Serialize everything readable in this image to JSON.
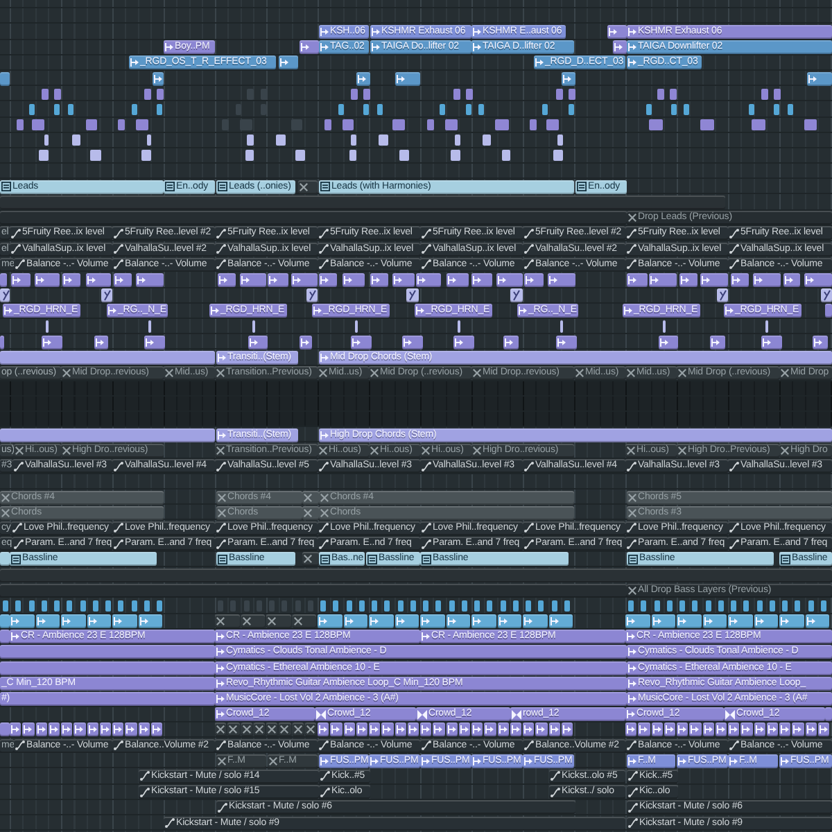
{
  "playlist": {
    "tracks": [
      {
        "clips": [
          {
            "kind": "audio",
            "color": "#7e8fd8",
            "label": "KSH..06"
          },
          {
            "kind": "audio",
            "color": "#7e8fd8",
            "label": "KSHMR Exhaust 06"
          },
          {
            "kind": "audio",
            "color": "#7e8fd8",
            "label": "KSHMR E..aust 06"
          },
          {
            "kind": "audio",
            "color": "#8c86d3"
          },
          {
            "kind": "audio",
            "color": "#8c86d3",
            "label": "KSHMR Exhaust 06"
          }
        ]
      },
      {
        "clips": [
          {
            "kind": "audio",
            "color": "#8c86d3",
            "label": "Boy..PM"
          },
          {
            "kind": "audio",
            "color": "#8c86d3"
          },
          {
            "kind": "audio",
            "color": "#5b97c8",
            "label": "TAG..02"
          },
          {
            "kind": "audio",
            "color": "#5b97c8",
            "label": "TAIGA Do..lifter 02"
          },
          {
            "kind": "audio",
            "color": "#5b97c8",
            "label": "TAIGA D..lifter 02"
          },
          {
            "kind": "audio",
            "color": "#8c86d3"
          },
          {
            "kind": "audio",
            "color": "#5b97c8",
            "label": "TAIGA Downlifter 02"
          }
        ]
      },
      {
        "clips": [
          {
            "kind": "audio",
            "color": "#5b97c8",
            "label": "_RGD_OS_T_R_EFFECT_03"
          },
          {
            "kind": "audio",
            "color": "#5b97c8"
          },
          {
            "kind": "audio",
            "color": "#5b97c8",
            "label": "_RGD_D..ECT_03"
          },
          {
            "kind": "audio",
            "color": "#5b97c8",
            "label": "_RGD..CT_03"
          }
        ]
      },
      {
        "clips": [
          {
            "kind": "plain",
            "color": "#5b97c8"
          },
          {
            "kind": "audio",
            "color": "#5b97c8"
          },
          {
            "kind": "audio",
            "color": "#5b97c8"
          },
          {
            "kind": "audio",
            "color": "#5b97c8"
          },
          {
            "kind": "audio",
            "color": "#5b97c8"
          },
          {
            "kind": "audio",
            "color": "#5b97c8"
          }
        ]
      },
      {
        "clips": [
          {
            "kind": "notes",
            "color": "#8f86d4"
          },
          {
            "kind": "notes",
            "color": "#39434a"
          },
          {
            "kind": "notes",
            "color": "#8f86d4"
          }
        ]
      },
      {
        "clips": [
          {
            "kind": "notes",
            "color": "#55a7d6"
          },
          {
            "kind": "notes",
            "color": "#39434a"
          },
          {
            "kind": "notes",
            "color": "#55a7d6"
          }
        ]
      },
      {
        "clips": [
          {
            "kind": "notes",
            "color": "#8f86d4"
          },
          {
            "kind": "notes",
            "color": "#39434a"
          },
          {
            "kind": "notes",
            "color": "#8f86d4"
          }
        ]
      },
      {
        "clips": [
          {
            "kind": "notes",
            "color": "#b7bbea"
          }
        ]
      },
      {
        "clips": [
          {
            "kind": "notes",
            "color": "#b7bbea"
          }
        ]
      },
      {
        "clips": [
          {
            "kind": "pattern",
            "color": "#a6cfe0",
            "label": "Leads"
          },
          {
            "kind": "pattern",
            "color": "#a6cfe0",
            "label": "En..ody"
          },
          {
            "kind": "pattern",
            "color": "#a6cfe0",
            "label": "Leads (..onies)"
          },
          {
            "kind": "muted",
            "color": "#30383c"
          },
          {
            "kind": "pattern",
            "color": "#a6cfe0",
            "label": "Leads (with Harmonies)"
          },
          {
            "kind": "pattern",
            "color": "#a6cfe0",
            "label": "En..ody"
          }
        ]
      },
      {
        "clips": [
          {
            "kind": "plain",
            "color": "#2a3135"
          }
        ]
      },
      {
        "clips": [
          {
            "kind": "plain",
            "color": "#262d31"
          },
          {
            "kind": "muted",
            "color": "#262d31",
            "label": "Drop Leads (Previous)"
          }
        ]
      },
      {
        "clips": [
          {
            "kind": "plain",
            "color": "#283035",
            "label": "el"
          },
          {
            "kind": "automation",
            "color": "#283035",
            "label": "5Fruity Ree..ix level"
          },
          {
            "kind": "automation",
            "color": "#283035",
            "label": "5Fruity Ree..level #2"
          },
          {
            "kind": "automation",
            "color": "#283035",
            "label": "5Fruity Ree..ix level"
          },
          {
            "kind": "automation",
            "color": "#283035",
            "label": "5Fruity Ree..ix level"
          },
          {
            "kind": "automation",
            "color": "#283035",
            "label": "5Fruity Ree..ix level"
          },
          {
            "kind": "automation",
            "color": "#283035",
            "label": "5Fruity Ree..level #2"
          },
          {
            "kind": "automation",
            "color": "#283035",
            "label": "5Fruity Ree..ix level"
          },
          {
            "kind": "automation",
            "color": "#283035",
            "label": "5Fruity Ree..ix level"
          }
        ]
      },
      {
        "clips": [
          {
            "kind": "plain",
            "color": "#283035",
            "label": "el"
          },
          {
            "kind": "automation",
            "color": "#283035",
            "label": "ValhallaSup..ix level"
          },
          {
            "kind": "automation",
            "color": "#283035",
            "label": "ValhallaSu..level #2"
          },
          {
            "kind": "automation",
            "color": "#283035",
            "label": "ValhallaSup..ix level"
          },
          {
            "kind": "automation",
            "color": "#283035",
            "label": "ValhallaSup..ix level"
          },
          {
            "kind": "automation",
            "color": "#283035",
            "label": "ValhallaSup..ix level"
          },
          {
            "kind": "automation",
            "color": "#283035",
            "label": "ValhallaSu..level #2"
          },
          {
            "kind": "automation",
            "color": "#283035",
            "label": "ValhallaSup..ix level"
          },
          {
            "kind": "automation",
            "color": "#283035",
            "label": "ValhallaSup..ix level"
          }
        ]
      },
      {
        "clips": [
          {
            "kind": "plain",
            "color": "#283035",
            "label": "me"
          },
          {
            "kind": "automation",
            "color": "#283035",
            "label": "Balance -..- Volume"
          },
          {
            "kind": "automation",
            "color": "#283035",
            "label": "Balance -..- Volume"
          },
          {
            "kind": "automation",
            "color": "#283035",
            "label": "Balance -..- Volume"
          },
          {
            "kind": "automation",
            "color": "#283035",
            "label": "Balance -..- Volume"
          },
          {
            "kind": "automation",
            "color": "#283035",
            "label": "Balance -..- Volume"
          },
          {
            "kind": "automation",
            "color": "#283035",
            "label": "Balance -..- Volume"
          },
          {
            "kind": "automation",
            "color": "#283035",
            "label": "Balance -..- Volume"
          },
          {
            "kind": "automation",
            "color": "#283035",
            "label": "Balance -..- Volume"
          }
        ]
      },
      {
        "clips": [
          {
            "kind": "run",
            "color": "#8c86d3"
          },
          {
            "kind": "run",
            "color": "#8c86d3"
          },
          {
            "kind": "run",
            "color": "#8c86d3"
          }
        ]
      },
      {
        "clips": [
          {
            "kind": "ramp",
            "color": "#b7bbea"
          },
          {
            "kind": "ramp",
            "color": "#b7bbea"
          },
          {
            "kind": "ramp",
            "color": "#b7bbea"
          },
          {
            "kind": "ramp",
            "color": "#b7bbea"
          },
          {
            "kind": "ramp",
            "color": "#b7bbea"
          },
          {
            "kind": "ramp",
            "color": "#b7bbea"
          },
          {
            "kind": "ramp",
            "color": "#b7bbea"
          }
        ]
      },
      {
        "clips": [
          {
            "kind": "audio",
            "color": "#8c86d3",
            "label": "_RGD_HRN_E"
          },
          {
            "kind": "audio",
            "color": "#8c86d3",
            "label": "_RG.._N_E"
          },
          {
            "kind": "audio",
            "color": "#8c86d3",
            "label": "_RGD_HRN_E"
          },
          {
            "kind": "audio",
            "color": "#8c86d3",
            "label": "_RGD_HRN_E"
          },
          {
            "kind": "audio",
            "color": "#8c86d3",
            "label": "_RGD_HRN_E"
          },
          {
            "kind": "audio",
            "color": "#8c86d3",
            "label": "_RG.._N_E"
          },
          {
            "kind": "audio",
            "color": "#8c86d3",
            "label": "_RGD_HRN_E"
          },
          {
            "kind": "audio",
            "color": "#8c86d3",
            "label": "_RGD_HRN_E"
          },
          {
            "kind": "plain",
            "color": "#8c86d3"
          }
        ]
      },
      {
        "clips": [
          {
            "kind": "notes",
            "color": "#b7bbea"
          }
        ]
      },
      {
        "clips": [
          {
            "kind": "run",
            "color": "#8c86d3"
          },
          {
            "kind": "run",
            "color": "#8c86d3"
          },
          {
            "kind": "run",
            "color": "#8c86d3"
          }
        ]
      },
      {
        "clips": [
          {
            "kind": "plain",
            "color": "#a0a2e2"
          },
          {
            "kind": "audio",
            "color": "#a0a2e2",
            "label": "Transiti..(Stem)"
          },
          {
            "kind": "audio",
            "color": "#a0a2e2",
            "label": "Mid Drop Chords (Stem)"
          }
        ]
      },
      {
        "clips": [
          {
            "kind": "plain",
            "color": "#30383c",
            "label": "op (..revious)"
          },
          {
            "kind": "muted",
            "color": "#30383c",
            "label": "Mid Drop..revious)"
          },
          {
            "kind": "muted",
            "color": "#30383c",
            "label": "Mid..us)"
          },
          {
            "kind": "muted",
            "color": "#30383c",
            "label": "Transition..Previous)"
          },
          {
            "kind": "muted",
            "color": "#30383c",
            "label": "Mid..us)"
          },
          {
            "kind": "muted",
            "color": "#30383c",
            "label": "Mid Drop (..revious)"
          },
          {
            "kind": "muted",
            "color": "#30383c",
            "label": "Mid Drop..revious)"
          },
          {
            "kind": "muted",
            "color": "#30383c",
            "label": "Mid..us)"
          },
          {
            "kind": "muted",
            "color": "#30383c",
            "label": "Mid..us)"
          },
          {
            "kind": "muted",
            "color": "#30383c",
            "label": "Mid Drop (..revious)"
          },
          {
            "kind": "muted",
            "color": "#30383c",
            "label": "Mid Drop"
          }
        ]
      },
      {
        "clips": [
          {
            "kind": "band",
            "color": "#1d2326"
          }
        ]
      },
      {
        "clips": [
          {
            "kind": "band",
            "color": "#1d2326"
          }
        ]
      },
      {
        "clips": [
          {
            "kind": "band",
            "color": "#1d2326"
          }
        ]
      },
      {
        "clips": [
          {
            "kind": "plain",
            "color": "#a0a2e2"
          },
          {
            "kind": "audio",
            "color": "#a0a2e2",
            "label": "Transiti..(Stem)"
          },
          {
            "kind": "audio",
            "color": "#a0a2e2",
            "label": "High Drop Chords (Stem)"
          }
        ]
      },
      {
        "clips": [
          {
            "kind": "plain",
            "color": "#30383c",
            "label": "us)"
          },
          {
            "kind": "muted",
            "color": "#30383c",
            "label": "Hi..ous)"
          },
          {
            "kind": "muted",
            "color": "#30383c",
            "label": "High Dro..revious)"
          },
          {
            "kind": "muted",
            "color": "#30383c",
            "label": "Transition..Previous)"
          },
          {
            "kind": "muted",
            "color": "#30383c",
            "label": "Hi..ous)"
          },
          {
            "kind": "muted",
            "color": "#30383c",
            "label": "Hi..ous)"
          },
          {
            "kind": "muted",
            "color": "#30383c",
            "label": "Hi..ous)"
          },
          {
            "kind": "muted",
            "color": "#30383c",
            "label": "High Dro..revious)"
          },
          {
            "kind": "muted",
            "color": "#30383c",
            "label": "Hi..ous)"
          },
          {
            "kind": "muted",
            "color": "#30383c",
            "label": "High Dro..Previous)"
          },
          {
            "kind": "muted",
            "color": "#30383c",
            "label": "High Dro"
          }
        ]
      },
      {
        "clips": [
          {
            "kind": "plain",
            "color": "#283035",
            "label": "#3"
          },
          {
            "kind": "automation",
            "color": "#283035",
            "label": "ValhallaSu..level #3"
          },
          {
            "kind": "automation",
            "color": "#283035",
            "label": "ValhallaSu..level #4"
          },
          {
            "kind": "automation",
            "color": "#283035",
            "label": "ValhallaSu..level #5"
          },
          {
            "kind": "automation",
            "color": "#283035",
            "label": "ValhallaSu..level #3"
          },
          {
            "kind": "automation",
            "color": "#283035",
            "label": "ValhallaSu..level #3"
          },
          {
            "kind": "automation",
            "color": "#283035",
            "label": "ValhallaSu..level #4"
          },
          {
            "kind": "automation",
            "color": "#283035",
            "label": "ValhallaSu..level #3"
          },
          {
            "kind": "automation",
            "color": "#283035",
            "label": "ValhallaSu..level #3"
          }
        ]
      },
      {
        "clips": [
          {
            "kind": "muted",
            "color": "#4a5357",
            "label": "Chords #4"
          },
          {
            "kind": "muted",
            "color": "#4a5357",
            "label": "Chords #4"
          },
          {
            "kind": "muted",
            "color": "#4a5357"
          },
          {
            "kind": "muted",
            "color": "#4a5357",
            "label": "Chords #4"
          },
          {
            "kind": "muted",
            "color": "#4a5357",
            "label": "Chords #5"
          }
        ]
      },
      {
        "clips": [
          {
            "kind": "muted",
            "color": "#4a5357",
            "label": "Chords"
          },
          {
            "kind": "muted",
            "color": "#4a5357",
            "label": "Chords"
          },
          {
            "kind": "muted",
            "color": "#4a5357"
          },
          {
            "kind": "muted",
            "color": "#4a5357",
            "label": "Chords"
          },
          {
            "kind": "muted",
            "color": "#4a5357",
            "label": "Chords #3"
          }
        ]
      },
      {
        "clips": [
          {
            "kind": "plain",
            "color": "#283035",
            "label": "cy"
          },
          {
            "kind": "automation",
            "color": "#283035",
            "label": "Love Phil..frequency"
          },
          {
            "kind": "automation",
            "color": "#283035",
            "label": "Love Phil..frequency"
          },
          {
            "kind": "automation",
            "color": "#283035",
            "label": "Love Phil..frequency"
          },
          {
            "kind": "automation",
            "color": "#283035",
            "label": "Love Phil..frequency"
          },
          {
            "kind": "automation",
            "color": "#283035",
            "label": "Love Phil..frequency"
          },
          {
            "kind": "automation",
            "color": "#283035",
            "label": "Love Phil..frequency"
          },
          {
            "kind": "automation",
            "color": "#283035",
            "label": "Love Phil..frequency"
          },
          {
            "kind": "automation",
            "color": "#283035",
            "label": "Love Phil..frequency"
          }
        ]
      },
      {
        "clips": [
          {
            "kind": "plain",
            "color": "#283035",
            "label": "eq"
          },
          {
            "kind": "automation",
            "color": "#283035",
            "label": "Param. E..and 7 freq"
          },
          {
            "kind": "automation",
            "color": "#283035",
            "label": "Param. E..and 7 freq"
          },
          {
            "kind": "automation",
            "color": "#283035",
            "label": "Param. E..and 7 freq"
          },
          {
            "kind": "automation",
            "color": "#283035",
            "label": "Param. E..nd 7 freq"
          },
          {
            "kind": "automation",
            "color": "#283035",
            "label": "Param. E..and 7 freq"
          },
          {
            "kind": "automation",
            "color": "#283035",
            "label": "Param. E..and 7 freq"
          },
          {
            "kind": "automation",
            "color": "#283035",
            "label": "Param. E..and 7 freq"
          },
          {
            "kind": "automation",
            "color": "#283035",
            "label": "Param. E..and 7 freq"
          }
        ]
      },
      {
        "clips": [
          {
            "kind": "plain",
            "color": "#a6cfe0"
          },
          {
            "kind": "pattern",
            "color": "#a6cfe0",
            "label": "Bassline"
          },
          {
            "kind": "pattern",
            "color": "#a6cfe0",
            "label": "Bassline"
          },
          {
            "kind": "muted",
            "color": "#30383c"
          },
          {
            "kind": "pattern",
            "color": "#a6cfe0",
            "label": "Bas..ne"
          },
          {
            "kind": "pattern",
            "color": "#a6cfe0",
            "label": "Bassline"
          },
          {
            "kind": "pattern",
            "color": "#a6cfe0",
            "label": "Bassline"
          },
          {
            "kind": "pattern",
            "color": "#a6cfe0",
            "label": "Bassline"
          },
          {
            "kind": "pattern",
            "color": "#a6cfe0",
            "label": "Bassline"
          }
        ]
      },
      {
        "clips": [
          {
            "kind": "plain",
            "color": "#2a3135"
          }
        ]
      },
      {
        "clips": [
          {
            "kind": "plain",
            "color": "#262d31"
          },
          {
            "kind": "muted",
            "color": "#262d31",
            "label": "All Drop Bass Layers (Previous)"
          }
        ]
      },
      {
        "clips": [
          {
            "kind": "notes",
            "color": "#55a7d6"
          },
          {
            "kind": "notes",
            "color": "#39434a"
          },
          {
            "kind": "notes",
            "color": "#55a7d6"
          },
          {
            "kind": "notes",
            "color": "#55a7d6"
          }
        ]
      },
      {
        "clips": [
          {
            "kind": "plain",
            "color": "#63acd6"
          },
          {
            "kind": "run",
            "color": "#63acd6"
          },
          {
            "kind": "muted-run",
            "color": "#30383c"
          },
          {
            "kind": "run",
            "color": "#63acd6"
          },
          {
            "kind": "run",
            "color": "#63acd6"
          }
        ]
      },
      {
        "clips": [
          {
            "kind": "plain",
            "color": "#8c86d3"
          },
          {
            "kind": "audio",
            "color": "#8c86d3",
            "label": "CR - Ambience 23 E 128BPM"
          },
          {
            "kind": "audio",
            "color": "#8c86d3",
            "label": "CR - Ambience 23 E 128BPM"
          },
          {
            "kind": "audio",
            "color": "#8c86d3",
            "label": "CR - Ambience 23 E 128BPM"
          },
          {
            "kind": "audio",
            "color": "#8c86d3",
            "label": "CR - Ambience 23 E 128BPM"
          }
        ]
      },
      {
        "clips": [
          {
            "kind": "plain",
            "color": "#8c86d3"
          },
          {
            "kind": "audio",
            "color": "#8c86d3",
            "label": "Cymatics - Clouds Tonal Ambience - D"
          },
          {
            "kind": "audio",
            "color": "#8c86d3",
            "label": "Cymatics - Clouds Tonal Ambience - D"
          }
        ]
      },
      {
        "clips": [
          {
            "kind": "plain",
            "color": "#8c86d3"
          },
          {
            "kind": "audio",
            "color": "#8c86d3",
            "label": "Cymatics - Ethereal Ambience 10 - E"
          },
          {
            "kind": "audio",
            "color": "#8c86d3",
            "label": "Cymatics - Ethereal Ambience 10 - E"
          }
        ]
      },
      {
        "clips": [
          {
            "kind": "plain",
            "color": "#8c86d3",
            "label": "_C Min_120 BPM"
          },
          {
            "kind": "audio",
            "color": "#8c86d3",
            "label": "Revo_Rhythmic Guitar Ambience Loop_C Min_120 BPM"
          },
          {
            "kind": "audio",
            "color": "#8c86d3",
            "label": "Revo_Rhythmic Guitar Ambience Loop_"
          }
        ]
      },
      {
        "clips": [
          {
            "kind": "plain",
            "color": "#8c86d3",
            "label": "#)"
          },
          {
            "kind": "audio",
            "color": "#8c86d3",
            "label": "MusicCore - Lost Vol 2 Ambience - 3 (A#)"
          },
          {
            "kind": "audio",
            "color": "#8c86d3",
            "label": "MusicCore - Lost Vol 2 Ambience - 3 (A#"
          }
        ]
      },
      {
        "clips": [
          {
            "kind": "audio",
            "color": "#8c86d3",
            "label": "Crowd_12"
          },
          {
            "kind": "cross",
            "color": "#8c86d3",
            "label": "Crowd_12"
          },
          {
            "kind": "cross",
            "color": "#8c86d3",
            "label": "Crowd_12"
          },
          {
            "kind": "cross",
            "color": "#8c86d3",
            "label": "rowd_12"
          },
          {
            "kind": "audio",
            "color": "#8c86d3",
            "label": "Crowd_12"
          },
          {
            "kind": "cross",
            "color": "#8c86d3",
            "label": "Crowd_12"
          },
          {
            "kind": "plain",
            "color": "#8c86d3"
          }
        ]
      },
      {
        "clips": [
          {
            "kind": "plain",
            "color": "#8c86d3"
          },
          {
            "kind": "run",
            "color": "#8c86d3"
          },
          {
            "kind": "muted-run",
            "color": "#30383c"
          },
          {
            "kind": "run",
            "color": "#8c86d3"
          },
          {
            "kind": "run",
            "color": "#8c86d3"
          }
        ]
      },
      {
        "clips": [
          {
            "kind": "plain",
            "color": "#283035",
            "label": "me"
          },
          {
            "kind": "automation",
            "color": "#283035",
            "label": "Balance -..- Volume"
          },
          {
            "kind": "automation",
            "color": "#283035",
            "label": "Balance..Volume #2"
          },
          {
            "kind": "automation",
            "color": "#283035",
            "label": "Balance -..- Volume"
          },
          {
            "kind": "automation",
            "color": "#283035",
            "label": "Balance -..- Volume"
          },
          {
            "kind": "automation",
            "color": "#283035",
            "label": "Balance -..- Volume"
          },
          {
            "kind": "automation",
            "color": "#283035",
            "label": "Balance..Volume #2"
          },
          {
            "kind": "automation",
            "color": "#283035",
            "label": "Balance -..- Volume"
          },
          {
            "kind": "automation",
            "color": "#283035",
            "label": "Balance -..- Volume"
          }
        ]
      },
      {
        "clips": [
          {
            "kind": "muted",
            "color": "#30383c",
            "label": "F..M"
          },
          {
            "kind": "muted",
            "color": "#30383c",
            "label": "F..M"
          },
          {
            "kind": "audio",
            "color": "#7e8fd8",
            "label": "FUS..PM"
          },
          {
            "kind": "audio",
            "color": "#7e8fd8",
            "label": "FUS..PM"
          },
          {
            "kind": "audio",
            "color": "#7e8fd8",
            "label": "FUS..PM"
          },
          {
            "kind": "audio",
            "color": "#7e8fd8",
            "label": "FUS..PM"
          },
          {
            "kind": "audio",
            "color": "#7e8fd8",
            "label": "FUS..PM"
          },
          {
            "kind": "audio",
            "color": "#7e8fd8",
            "label": "F..M"
          },
          {
            "kind": "audio",
            "color": "#7e8fd8",
            "label": "FUS..PM"
          },
          {
            "kind": "audio",
            "color": "#7e8fd8",
            "label": "F..M"
          },
          {
            "kind": "audio",
            "color": "#7e8fd8",
            "label": "FUS..PM"
          }
        ]
      },
      {
        "clips": [
          {
            "kind": "automation",
            "color": "#283035",
            "label": "Kickstart - Mute / solo #14"
          },
          {
            "kind": "automation",
            "color": "#283035",
            "label": "Kick..#5"
          },
          {
            "kind": "automation",
            "color": "#283035",
            "label": "Kickst..olo #5"
          },
          {
            "kind": "automation",
            "color": "#283035",
            "label": "Kick..#5"
          }
        ]
      },
      {
        "clips": [
          {
            "kind": "automation",
            "color": "#283035",
            "label": "Kickstart - Mute / solo #15"
          },
          {
            "kind": "automation",
            "color": "#283035",
            "label": "Kic..olo"
          },
          {
            "kind": "automation",
            "color": "#283035",
            "label": "Kickst../ solo"
          },
          {
            "kind": "automation",
            "color": "#283035",
            "label": "Kic..olo"
          }
        ]
      },
      {
        "clips": [
          {
            "kind": "automation",
            "color": "#283035",
            "label": "Kickstart - Mute / solo #6"
          },
          {
            "kind": "automation",
            "color": "#283035",
            "label": "Kickstart - Mute / solo #6"
          }
        ]
      },
      {
        "clips": [
          {
            "kind": "automation",
            "color": "#283035",
            "label": "Kickstart - Mute / solo #9"
          },
          {
            "kind": "automation",
            "color": "#283035",
            "label": "Kickstart - Mute / solo #9"
          }
        ]
      }
    ]
  }
}
